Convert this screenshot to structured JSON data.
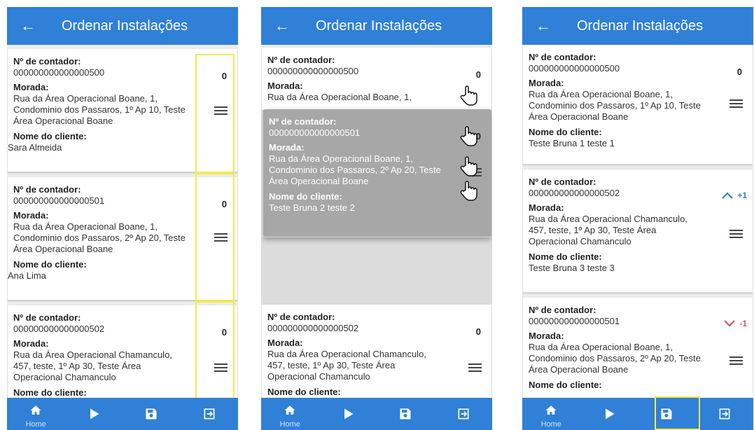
{
  "header": {
    "title": "Ordenar Instalações",
    "back_icon": "arrow-left-icon"
  },
  "labels": {
    "meter": "Nº de contador:",
    "address": "Morada:",
    "client": "Nome do cliente:"
  },
  "nav": {
    "home_label": "Home",
    "icons": [
      "home-icon",
      "play-icon",
      "save-icon",
      "logout-icon"
    ]
  },
  "colors": {
    "primary": "#2f80d6",
    "highlight": "#f2e94e",
    "up": "#2f80d6",
    "down": "#e0505a",
    "drag_card": "#a7a7a7"
  },
  "screens": [
    {
      "cards": [
        {
          "meter": "000000000000000500",
          "address": "Rua da Área Operacional Boane, 1, Condominio dos Passaros, 1º Ap 10, Teste Área Operacional Boane",
          "client": "Sara Almeida",
          "count": "0"
        },
        {
          "meter": "000000000000000501",
          "address": "Rua da Área Operacional Boane, 1, Condominio dos Passaros, 2º Ap 20, Teste Área Operacional Boane",
          "client": "Ana Lima",
          "count": "0"
        },
        {
          "meter": "000000000000000502",
          "address": "Rua da Área Operacional Chamanculo, 457, teste, 1º Ap 30, Teste Área Operacional Chamanculo",
          "client": "",
          "count": "0"
        }
      ]
    },
    {
      "cards": [
        {
          "meter": "000000000000000500",
          "address": "Rua da Área Operacional Boane, 1,",
          "client": "",
          "count": "0"
        },
        {
          "meter": "000000000000000501",
          "address": "Rua da Área Operacional Boane, 1, Condominio dos Passaros, 2º Ap 20, Teste Área Operacional Boane",
          "client": "Teste Bruna 2 teste 2",
          "count": "0"
        },
        {
          "meter": "000000000000000502",
          "address": "Rua da Área Operacional Chamanculo, 457, teste, 1º Ap 30, Teste Área Operacional Chamanculo",
          "client": "",
          "count": "0"
        }
      ]
    },
    {
      "cards": [
        {
          "meter": "000000000000000500",
          "address": "Rua da Área Operacional Boane, 1, Condominio dos Passaros, 1º Ap 10, Teste Área Operacional Boane",
          "client": "Teste Bruna 1 teste 1",
          "count": "0"
        },
        {
          "meter": "000000000000000502",
          "address": "Rua da Área Operacional Chamanculo, 457, teste, 1º Ap 30, Teste Área Operacional Chamanculo",
          "client": "Teste Bruna 3 teste 3",
          "move": "+1",
          "move_icon": "chevron-up-icon"
        },
        {
          "meter": "000000000000000501",
          "address": "Rua da Área Operacional Boane, 1, Condominio dos Passaros, 2º Ap 20, Teste Área Operacional Boane",
          "client": "",
          "move": "-1",
          "move_icon": "chevron-down-icon"
        }
      ]
    }
  ]
}
